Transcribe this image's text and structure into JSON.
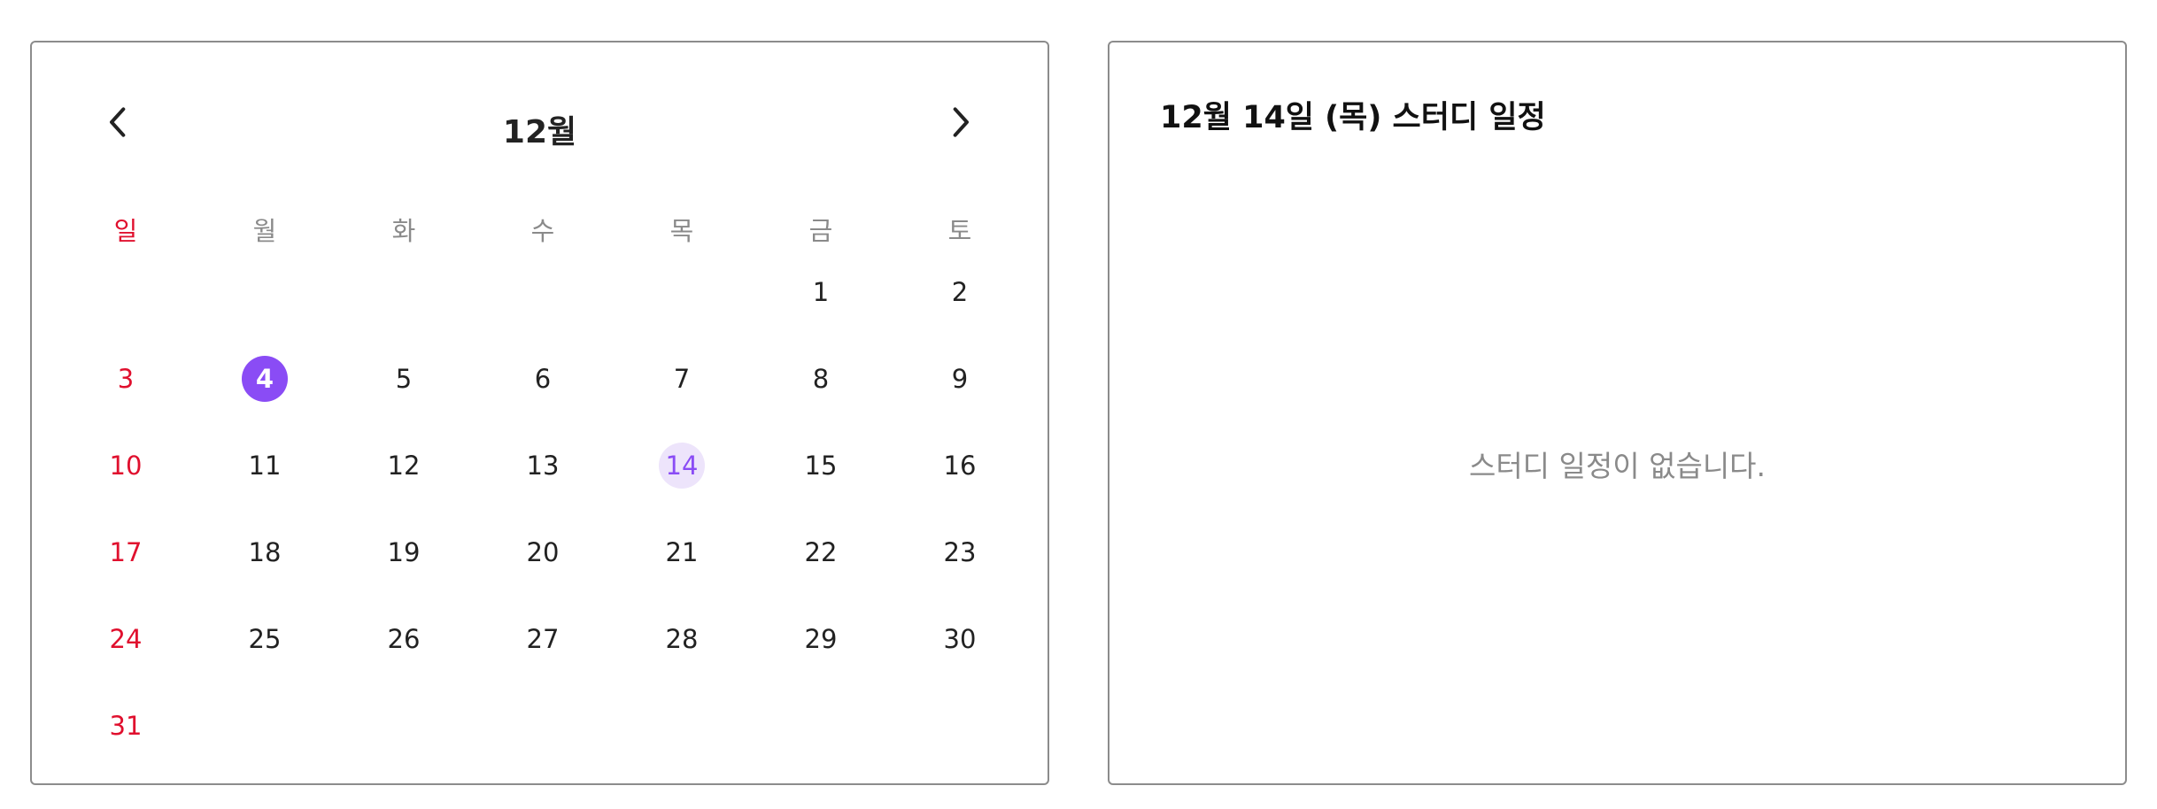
{
  "calendar": {
    "month_title": "12월",
    "weekdays": [
      "일",
      "월",
      "화",
      "수",
      "목",
      "금",
      "토"
    ],
    "first_weekday_index": 5,
    "days_in_month": 31,
    "today": 4,
    "selected": 14
  },
  "schedule": {
    "title": "12월 14일 (목) 스터디 일정",
    "empty_message": "스터디 일정이 없습니다."
  },
  "colors": {
    "sunday": "#e0102e",
    "accent": "#8a4cf5",
    "selected_bg": "#ede4fb",
    "muted": "#8a8a8a",
    "border": "#8c8c8c"
  },
  "icons": {
    "prev": "chevron-left-icon",
    "next": "chevron-right-icon"
  }
}
